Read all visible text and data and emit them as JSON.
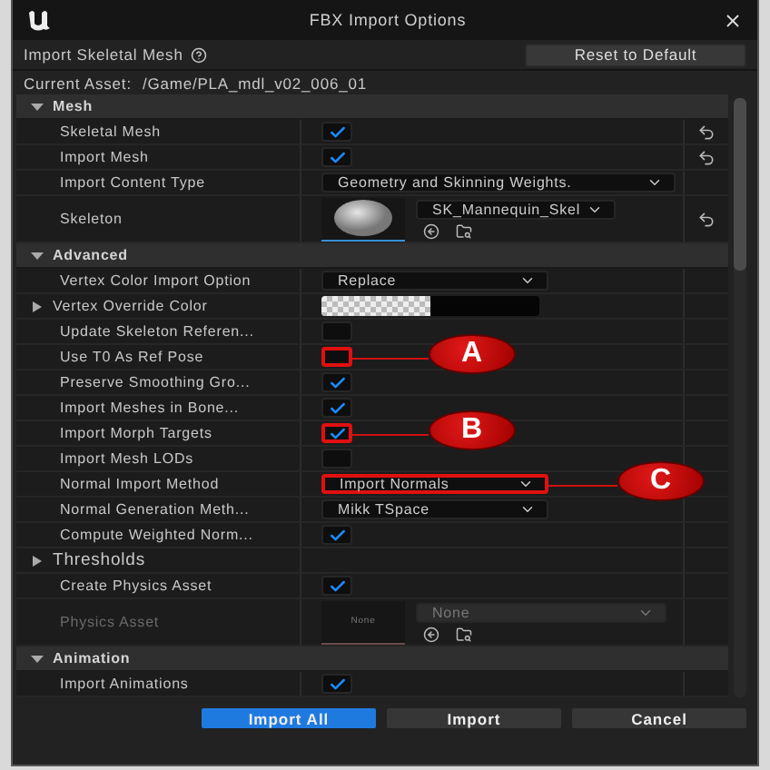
{
  "window": {
    "title": "FBX Import Options"
  },
  "header": {
    "title": "Import Skeletal Mesh",
    "reset_button": "Reset to Default"
  },
  "current_asset": {
    "label": "Current Asset:",
    "value": "/Game/PLA_mdl_v02_006_01"
  },
  "sections": [
    {
      "title": "Mesh",
      "expanded": true,
      "rows": [
        {
          "kind": "checkbox",
          "label": "Skeletal Mesh",
          "checked": true,
          "reset": true
        },
        {
          "kind": "checkbox",
          "label": "Import Mesh",
          "checked": true,
          "reset": true
        },
        {
          "kind": "dropdown",
          "label": "Import Content Type",
          "value": "Geometry and Skinning Weights.",
          "wide": true
        },
        {
          "kind": "asset",
          "label": "Skeleton",
          "value": "SK_Mannequin_Skel",
          "reset": true
        }
      ]
    },
    {
      "title": "Advanced",
      "expanded": true,
      "rows": [
        {
          "kind": "dropdown",
          "label": "Vertex Color Import Option",
          "value": "Replace"
        },
        {
          "kind": "color",
          "label": "Vertex Override Color",
          "expanded": false
        },
        {
          "kind": "checkbox",
          "label": "Update Skeleton Referen...",
          "checked": false
        },
        {
          "kind": "checkbox",
          "label": "Use T0 As Ref Pose",
          "checked": false,
          "callout": "A"
        },
        {
          "kind": "checkbox",
          "label": "Preserve Smoothing Gro...",
          "checked": true
        },
        {
          "kind": "checkbox",
          "label": "Import Meshes in Bone...",
          "checked": true
        },
        {
          "kind": "checkbox",
          "label": "Import Morph Targets",
          "checked": true,
          "callout": "B"
        },
        {
          "kind": "checkbox",
          "label": "Import Mesh LODs",
          "checked": false
        },
        {
          "kind": "dropdown",
          "label": "Normal Import Method",
          "value": "Import Normals",
          "callout": "C"
        },
        {
          "kind": "dropdown",
          "label": "Normal Generation Meth...",
          "value": "Mikk TSpace"
        },
        {
          "kind": "checkbox",
          "label": "Compute Weighted Norm...",
          "checked": true
        },
        {
          "kind": "group",
          "label": "Thresholds",
          "expanded": false
        },
        {
          "kind": "checkbox",
          "label": "Create Physics Asset",
          "checked": true
        },
        {
          "kind": "asset",
          "label": "Physics Asset",
          "value": "None",
          "thumb_text": "None",
          "disabled": true
        }
      ]
    },
    {
      "title": "Animation",
      "expanded": true,
      "rows": [
        {
          "kind": "checkbox",
          "label": "Import Animations",
          "checked": true
        }
      ]
    }
  ],
  "buttons": [
    {
      "label": "Import All",
      "primary": true
    },
    {
      "label": "Import",
      "primary": false
    },
    {
      "label": "Cancel",
      "primary": false
    }
  ]
}
